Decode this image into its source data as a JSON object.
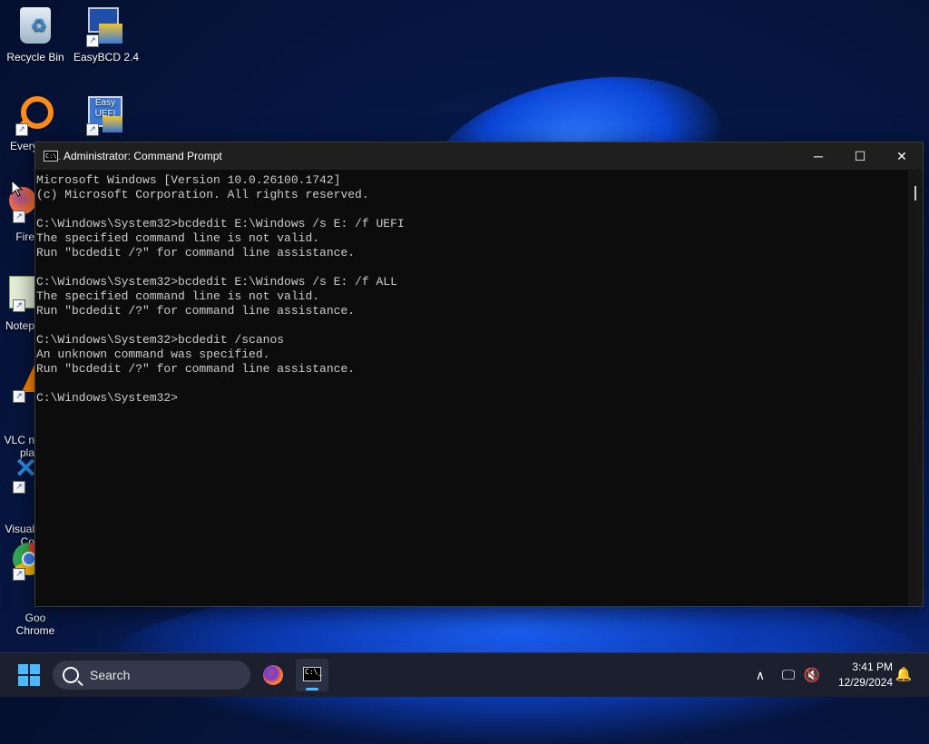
{
  "desktop": {
    "icons": [
      {
        "label": "Recycle Bin",
        "icon": "recycle-bin-icon"
      },
      {
        "label": "EasyBCD 2.4",
        "icon": "easybcd-icon"
      },
      {
        "label": "Every",
        "icon": "everything-search-icon"
      },
      {
        "label": "Easy UEFI",
        "icon": "easyuefi-icon",
        "screen_text": "Easy UEFI"
      },
      {
        "label": "Fire",
        "icon": "firefox-icon"
      },
      {
        "label": "Notep",
        "icon": "notepad-plus-plus-icon"
      },
      {
        "label": "VLC n\npla",
        "icon": "vlc-icon"
      },
      {
        "label": "Visual\nCo",
        "icon": "vscode-icon"
      },
      {
        "label": "Goo\nChrome",
        "icon": "chrome-icon"
      }
    ]
  },
  "window": {
    "title": "Administrator: Command Prompt",
    "icon_text": "C:\\_",
    "controls": {
      "minimize": "─",
      "maximize": "☐",
      "close": "✕"
    },
    "console_lines": [
      "Microsoft Windows [Version 10.0.26100.1742]",
      "(c) Microsoft Corporation. All rights reserved.",
      "",
      "C:\\Windows\\System32>bcdedit E:\\Windows /s E: /f UEFI",
      "The specified command line is not valid.",
      "Run \"bcdedit /?\" for command line assistance.",
      "",
      "C:\\Windows\\System32>bcdedit E:\\Windows /s E: /f ALL",
      "The specified command line is not valid.",
      "Run \"bcdedit /?\" for command line assistance.",
      "",
      "C:\\Windows\\System32>bcdedit /scanos",
      "An unknown command was specified.",
      "Run \"bcdedit /?\" for command line assistance.",
      "",
      "C:\\Windows\\System32>"
    ]
  },
  "taskbar": {
    "search_placeholder": "Search",
    "apps": [
      {
        "name": "firefox",
        "icon": "firefox-icon"
      },
      {
        "name": "command-prompt",
        "icon": "cmd-icon",
        "glyph": "C:\\_",
        "active": true
      }
    ],
    "tray": {
      "chevron": "∧",
      "network": "🖵",
      "volume": "🔇"
    },
    "clock": {
      "time": "3:41 PM",
      "date": "12/29/2024"
    },
    "notification_icon": "bell-icon"
  },
  "colors": {
    "accent": "#4cb8ff",
    "console_bg": "#0c0c0c",
    "console_fg": "#cccccc",
    "taskbar_bg": "#1b1f2e"
  }
}
